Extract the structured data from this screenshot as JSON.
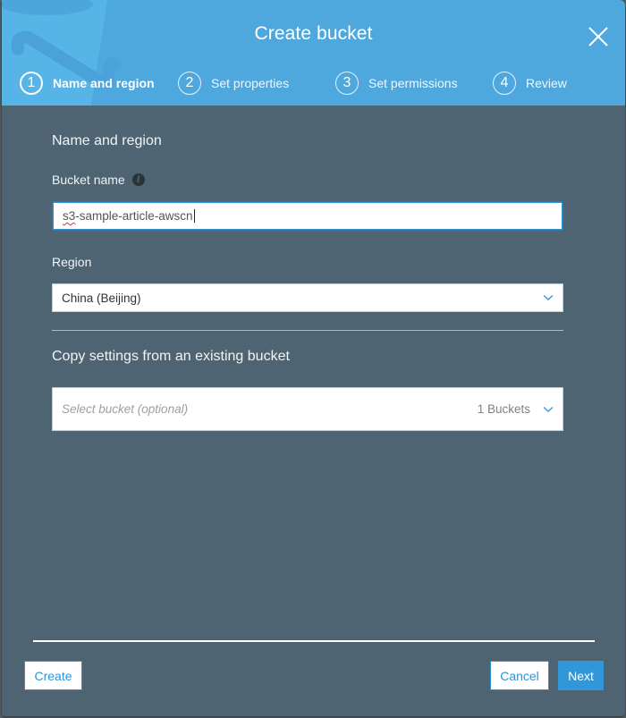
{
  "dialog": {
    "title": "Create bucket",
    "close_icon": "close-icon"
  },
  "steps": [
    {
      "number": "1",
      "label": "Name and region",
      "state": "active"
    },
    {
      "number": "2",
      "label": "Set properties",
      "state": "inactive"
    },
    {
      "number": "3",
      "label": "Set permissions",
      "state": "inactive"
    },
    {
      "number": "4",
      "label": "Review",
      "state": "inactive"
    }
  ],
  "form": {
    "section_title": "Name and region",
    "bucket_name": {
      "label": "Bucket name",
      "info_icon": "info-icon",
      "value_prefix": "s3",
      "value_rest": "-sample-article-awscn"
    },
    "region": {
      "label": "Region",
      "value": "China (Beijing)",
      "icon": "chevron-down-icon"
    },
    "copy_settings": {
      "title": "Copy settings from an existing bucket",
      "placeholder": "Select bucket (optional)",
      "count": "1 Buckets",
      "icon": "chevron-down-icon"
    }
  },
  "footer": {
    "create_label": "Create",
    "cancel_label": "Cancel",
    "next_label": "Next"
  },
  "colors": {
    "header": "#4ea8dd",
    "body": "#4f6472",
    "accent": "#3197d8"
  }
}
